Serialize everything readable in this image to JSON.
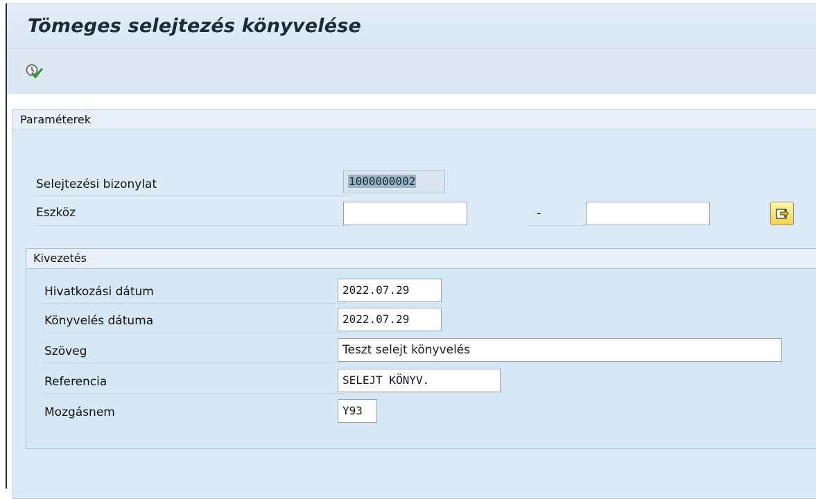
{
  "window": {
    "title": "Tömeges selejtezés könyvelése"
  },
  "toolbar": {
    "execute_icon": "execute-icon"
  },
  "parameters": {
    "header": "Paraméterek",
    "doc_label": "Selejtezési bizonylat",
    "doc_value": "1000000002",
    "asset_label": "Eszköz",
    "asset_from": "",
    "asset_to": "",
    "range_separator": "-",
    "multiple_selection_icon": "multiple-selection-icon"
  },
  "exit": {
    "header": "Kivezetés",
    "rows": [
      {
        "label": "Hivatkozási dátum",
        "value": "2022.07.29"
      },
      {
        "label": "Könyvelés dátuma",
        "value": "2022.07.29"
      },
      {
        "label": "Szöveg",
        "value": "Teszt selejt könyvelés"
      },
      {
        "label": "Referencia",
        "value": "SELEJT KÖNYV."
      },
      {
        "label": "Mozgásnem",
        "value": "Y93"
      }
    ]
  },
  "colors": {
    "title_text": "#1b2b3c",
    "panel_bg": "#dcebf7",
    "field_bg": "#ffffff",
    "button_yellow": "#f3d34a"
  }
}
